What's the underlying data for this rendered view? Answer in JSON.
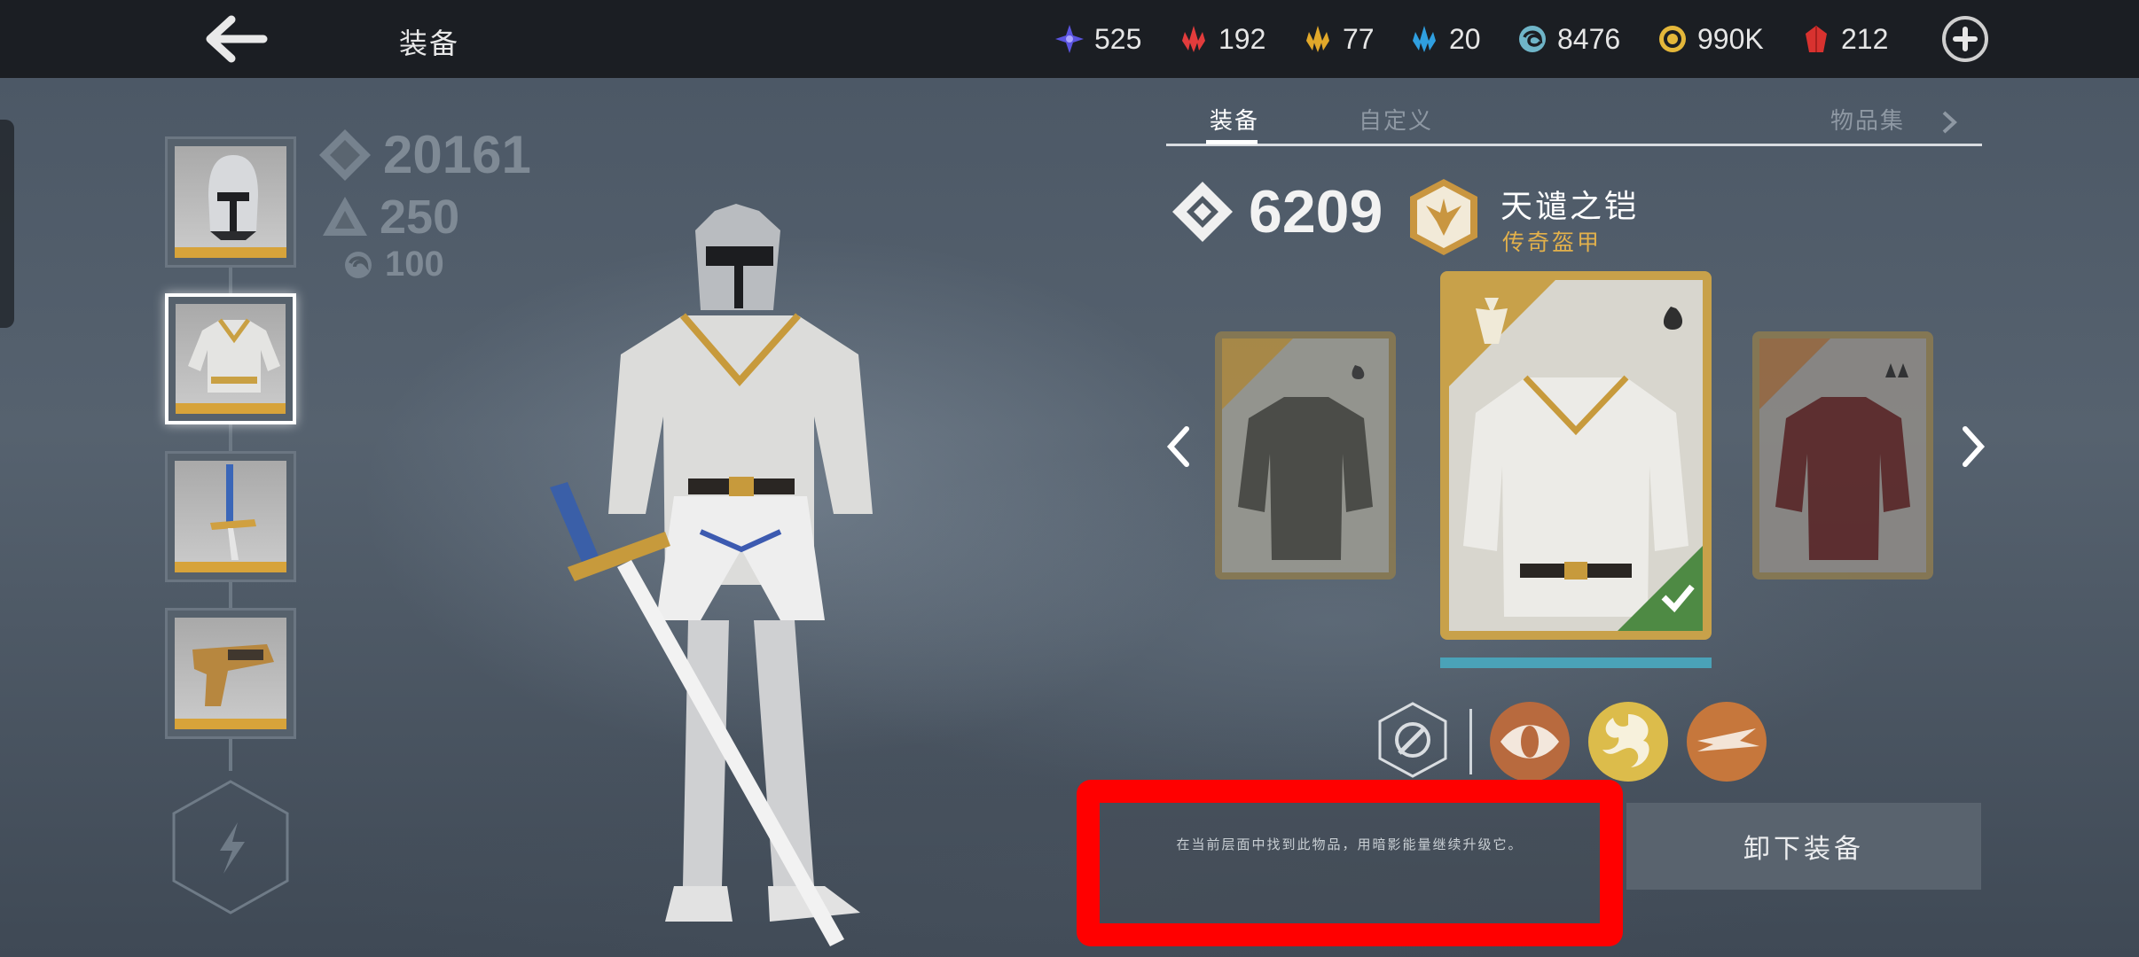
{
  "header": {
    "title": "装备",
    "currencies": [
      {
        "icon": "purple-star-icon",
        "value": "525",
        "color": "#6a5ce8"
      },
      {
        "icon": "red-crystal-icon",
        "value": "192",
        "color": "#e23c3c"
      },
      {
        "icon": "gold-crystal-icon",
        "value": "77",
        "color": "#e1a82a"
      },
      {
        "icon": "blue-crystal-icon",
        "value": "20",
        "color": "#2f9fe0"
      },
      {
        "icon": "shadow-swirl-icon",
        "value": "8476",
        "color": "#6fb5c8"
      },
      {
        "icon": "gold-coin-icon",
        "value": "990K",
        "color": "#e4b73a"
      },
      {
        "icon": "red-gem-icon",
        "value": "212",
        "color": "#d8322f"
      }
    ]
  },
  "stats": {
    "total_power": "20161",
    "level": "250",
    "shadow": "100"
  },
  "tabs": [
    "装备",
    "自定义",
    "物品集"
  ],
  "item": {
    "power": "6209",
    "name": "天谴之铠",
    "rarity": "传奇盔甲",
    "rarity_color": "#e3b14b"
  },
  "description": "在当前层面中找到此物品，用暗影能量继续升级它。",
  "unequip_label": "卸下装备"
}
